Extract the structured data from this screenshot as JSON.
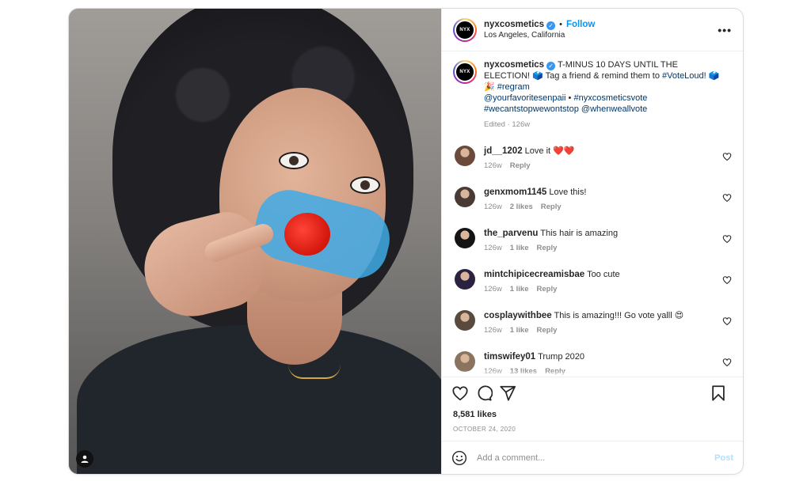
{
  "post": {
    "account": {
      "username": "nyxcosmetics",
      "location": "Los Angeles, California",
      "follow_label": "Follow",
      "avatar_text": "NYX",
      "dot": "•"
    },
    "caption": {
      "text_1": "T-MINUS 10 DAYS UNTIL THE ELECTION! ",
      "emoji_1": "🗳️",
      "text_2": " Tag a friend & remind them to ",
      "tag_voteloud": "#VoteLoud!",
      "emoji_2": " 🗳️🎉 ",
      "tag_regram": "#regram",
      "mention_1": "@yourfavoritesenpaii",
      "sep": " • ",
      "tag_vote": "#nyxcosmeticsvote",
      "tag_wecant": "#wecantstopwewontstop",
      "mention_2": "@whenweallvote",
      "meta": "Edited · 126w"
    },
    "comments": [
      {
        "user": "jd__1202",
        "text": "Love it ❤️❤️",
        "age": "126w",
        "likes": "",
        "reply": "Reply",
        "avatar_color": "#6b4a3c"
      },
      {
        "user": "genxmom1145",
        "text": "Love this!",
        "age": "126w",
        "likes": "2 likes",
        "reply": "Reply",
        "avatar_color": "#4a3a36"
      },
      {
        "user": "the_parvenu",
        "text": "This hair is amazing",
        "age": "126w",
        "likes": "1 like",
        "reply": "Reply",
        "avatar_color": "#141414"
      },
      {
        "user": "mintchipicecreamisbae",
        "text": "Too cute",
        "age": "126w",
        "likes": "1 like",
        "reply": "Reply",
        "avatar_color": "#2a2240"
      },
      {
        "user": "cosplaywithbee",
        "text": "This is amazing!!! Go vote yalll 😍",
        "age": "126w",
        "likes": "1 like",
        "reply": "Reply",
        "avatar_color": "#5a4a3e"
      },
      {
        "user": "timswifey01",
        "text": "Trump 2020",
        "age": "126w",
        "likes": "13 likes",
        "reply": "Reply",
        "avatar_color": "#8a7460"
      }
    ],
    "likes": "8,581 likes",
    "date": "OCTOBER 24, 2020",
    "add_comment": {
      "placeholder": "Add a comment...",
      "post_label": "Post"
    },
    "colors": {
      "accent": "#0095f6",
      "link": "#00376b",
      "muted": "#8e8e8e",
      "heart_red": "#ed4956"
    },
    "icons": [
      "more-icon",
      "verified-icon",
      "heart-icon",
      "comment-icon",
      "share-icon",
      "bookmark-icon",
      "emoji-icon",
      "user-tag-icon"
    ]
  }
}
